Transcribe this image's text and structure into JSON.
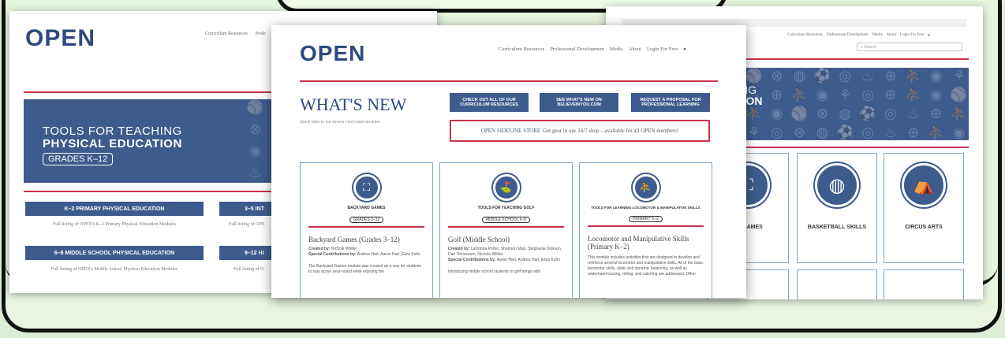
{
  "left_shot": {
    "logo": "OPEN",
    "nav_items": [
      "Curriculum Resources",
      "Profe"
    ],
    "banner_line1": "TOOLS FOR TEACHING",
    "banner_line2": "PHYSICAL EDUCATION",
    "banner_grades": "GRADES K–12",
    "buttons": [
      {
        "label": "K–2 PRIMARY PHYSICAL EDUCATION",
        "desc": "Full listing of OPEN's K–2 Primary Physical Education Modules"
      },
      {
        "label": "3–5 INT",
        "desc": "Full listing of OPE"
      },
      {
        "label": "6–8 MIDDLE SCHOOL PHYSICAL EDUCATION",
        "desc": "Full listing of OPEN's Middle School Physical Education Modules"
      },
      {
        "label": "9–12 HI",
        "desc": "Full listing of O"
      }
    ]
  },
  "center_shot": {
    "logo": "OPEN",
    "nav_items": [
      "Curriculum Resources",
      "Professional Development",
      "Media",
      "About",
      "Login For Free"
    ],
    "title": "WHAT'S NEW",
    "subtitle": "Quick links to our newest curriculum modules",
    "cta_buttons": [
      "CHECK OUT ALL OF OUR CURRICULUM RESOURCES",
      "SEE WHAT'S NEW ON BELIEVEINYOU.COM",
      "REQUEST A PROPOSAL FOR PROFESSIONAL LEARNING"
    ],
    "store_link": "OPEN SIDELINE STORE",
    "store_text": "Get gear in our 24/7 shop – available for all OPEN members!",
    "cards": [
      {
        "tag": "BACKYARD GAMES",
        "grade_pill": "GRADES 3–12",
        "title": "Backyard Games (Grades 3–12)",
        "created_label": "Created by:",
        "created": "Nichole Wilder",
        "contrib_label": "Special Contributions by:",
        "contrib": "Andrea Hart, Aaron Hart, Eliza Kuhn",
        "body": "The Backyard Games module was created as a way for students to stay active year-round while enjoying the"
      },
      {
        "tag": "TOOLS FOR TEACHING GOLF",
        "grade_pill": "MIDDLE SCHOOL 6–8",
        "title": "Golf (Middle School)",
        "created_label": "Created by:",
        "created": "LaDonda Porter, Shannon Maly, Stephanie Dickson, Dan Tennessen, Nichole Wilder",
        "contrib_label": "Special Contributions by:",
        "contrib": "Aaron Hart, Andrea Hart, Eliza Kuhn",
        "body": "Introducing middle school students to golf brings with"
      },
      {
        "tag": "TOOLS FOR LEARNING LOCOMOTOR & MANIPULATIVE SKILLS",
        "grade_pill": "PRIMARY K–2",
        "title": "Locomotor and Manipulative Skills (Primary K–2)",
        "created_label": "",
        "created": "",
        "contrib_label": "",
        "contrib": "",
        "body": "This module includes activities that are designed to develop and reinforce several locomotor and manipulative skills. All of the basic locomotor skills, static and dynamic balancing, as well as underhand tossing, rolling, and catching are addressed. Other"
      }
    ]
  },
  "right_shot": {
    "nav_items": [
      "Curriculum Resources",
      "Professional Development",
      "Media",
      "About",
      "Login For Free"
    ],
    "search_placeholder": "Search",
    "banner_line1": "HING",
    "banner_line2": "ATION",
    "tiles": [
      "RD GAMES",
      "BASKETBALL SKILLS",
      "CIRCUS ARTS"
    ]
  },
  "colors": {
    "navy": "#3d5b8d",
    "accent_red": "#c9354b",
    "frame_green": "#e9f6e2"
  }
}
